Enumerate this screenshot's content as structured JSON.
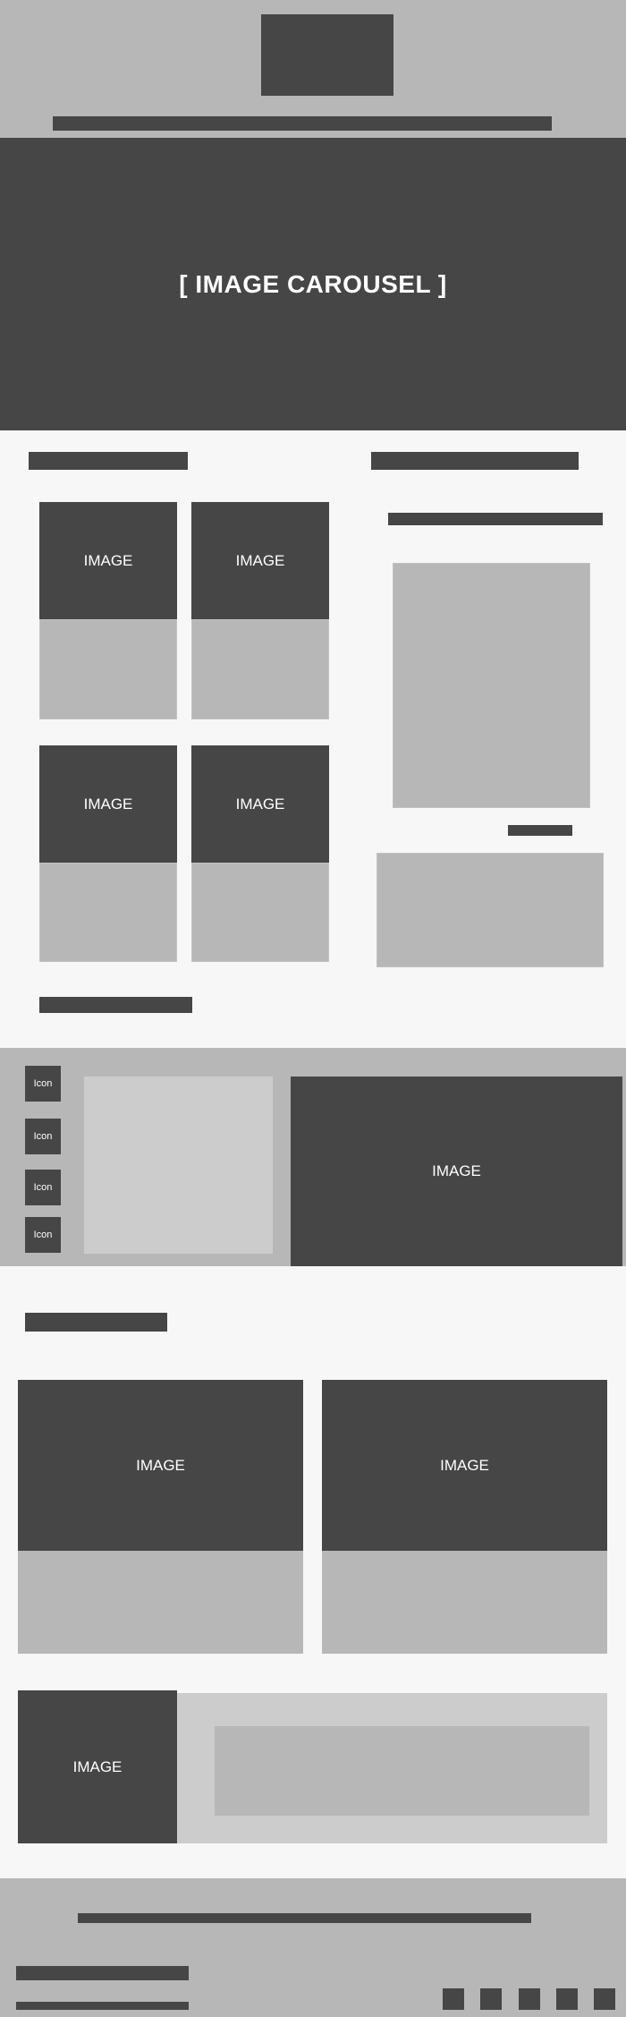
{
  "carousel": {
    "label": "[ IMAGE CAROUSEL ]"
  },
  "image_label": "IMAGE",
  "feature": {
    "icons": [
      {
        "label": "Icon"
      },
      {
        "label": "Icon"
      },
      {
        "label": "Icon"
      },
      {
        "label": "Icon"
      }
    ]
  },
  "colors": {
    "dark": "#464646",
    "mid": "#b7b7b7",
    "light": "#cccccc",
    "page": "#f7f7f7"
  }
}
